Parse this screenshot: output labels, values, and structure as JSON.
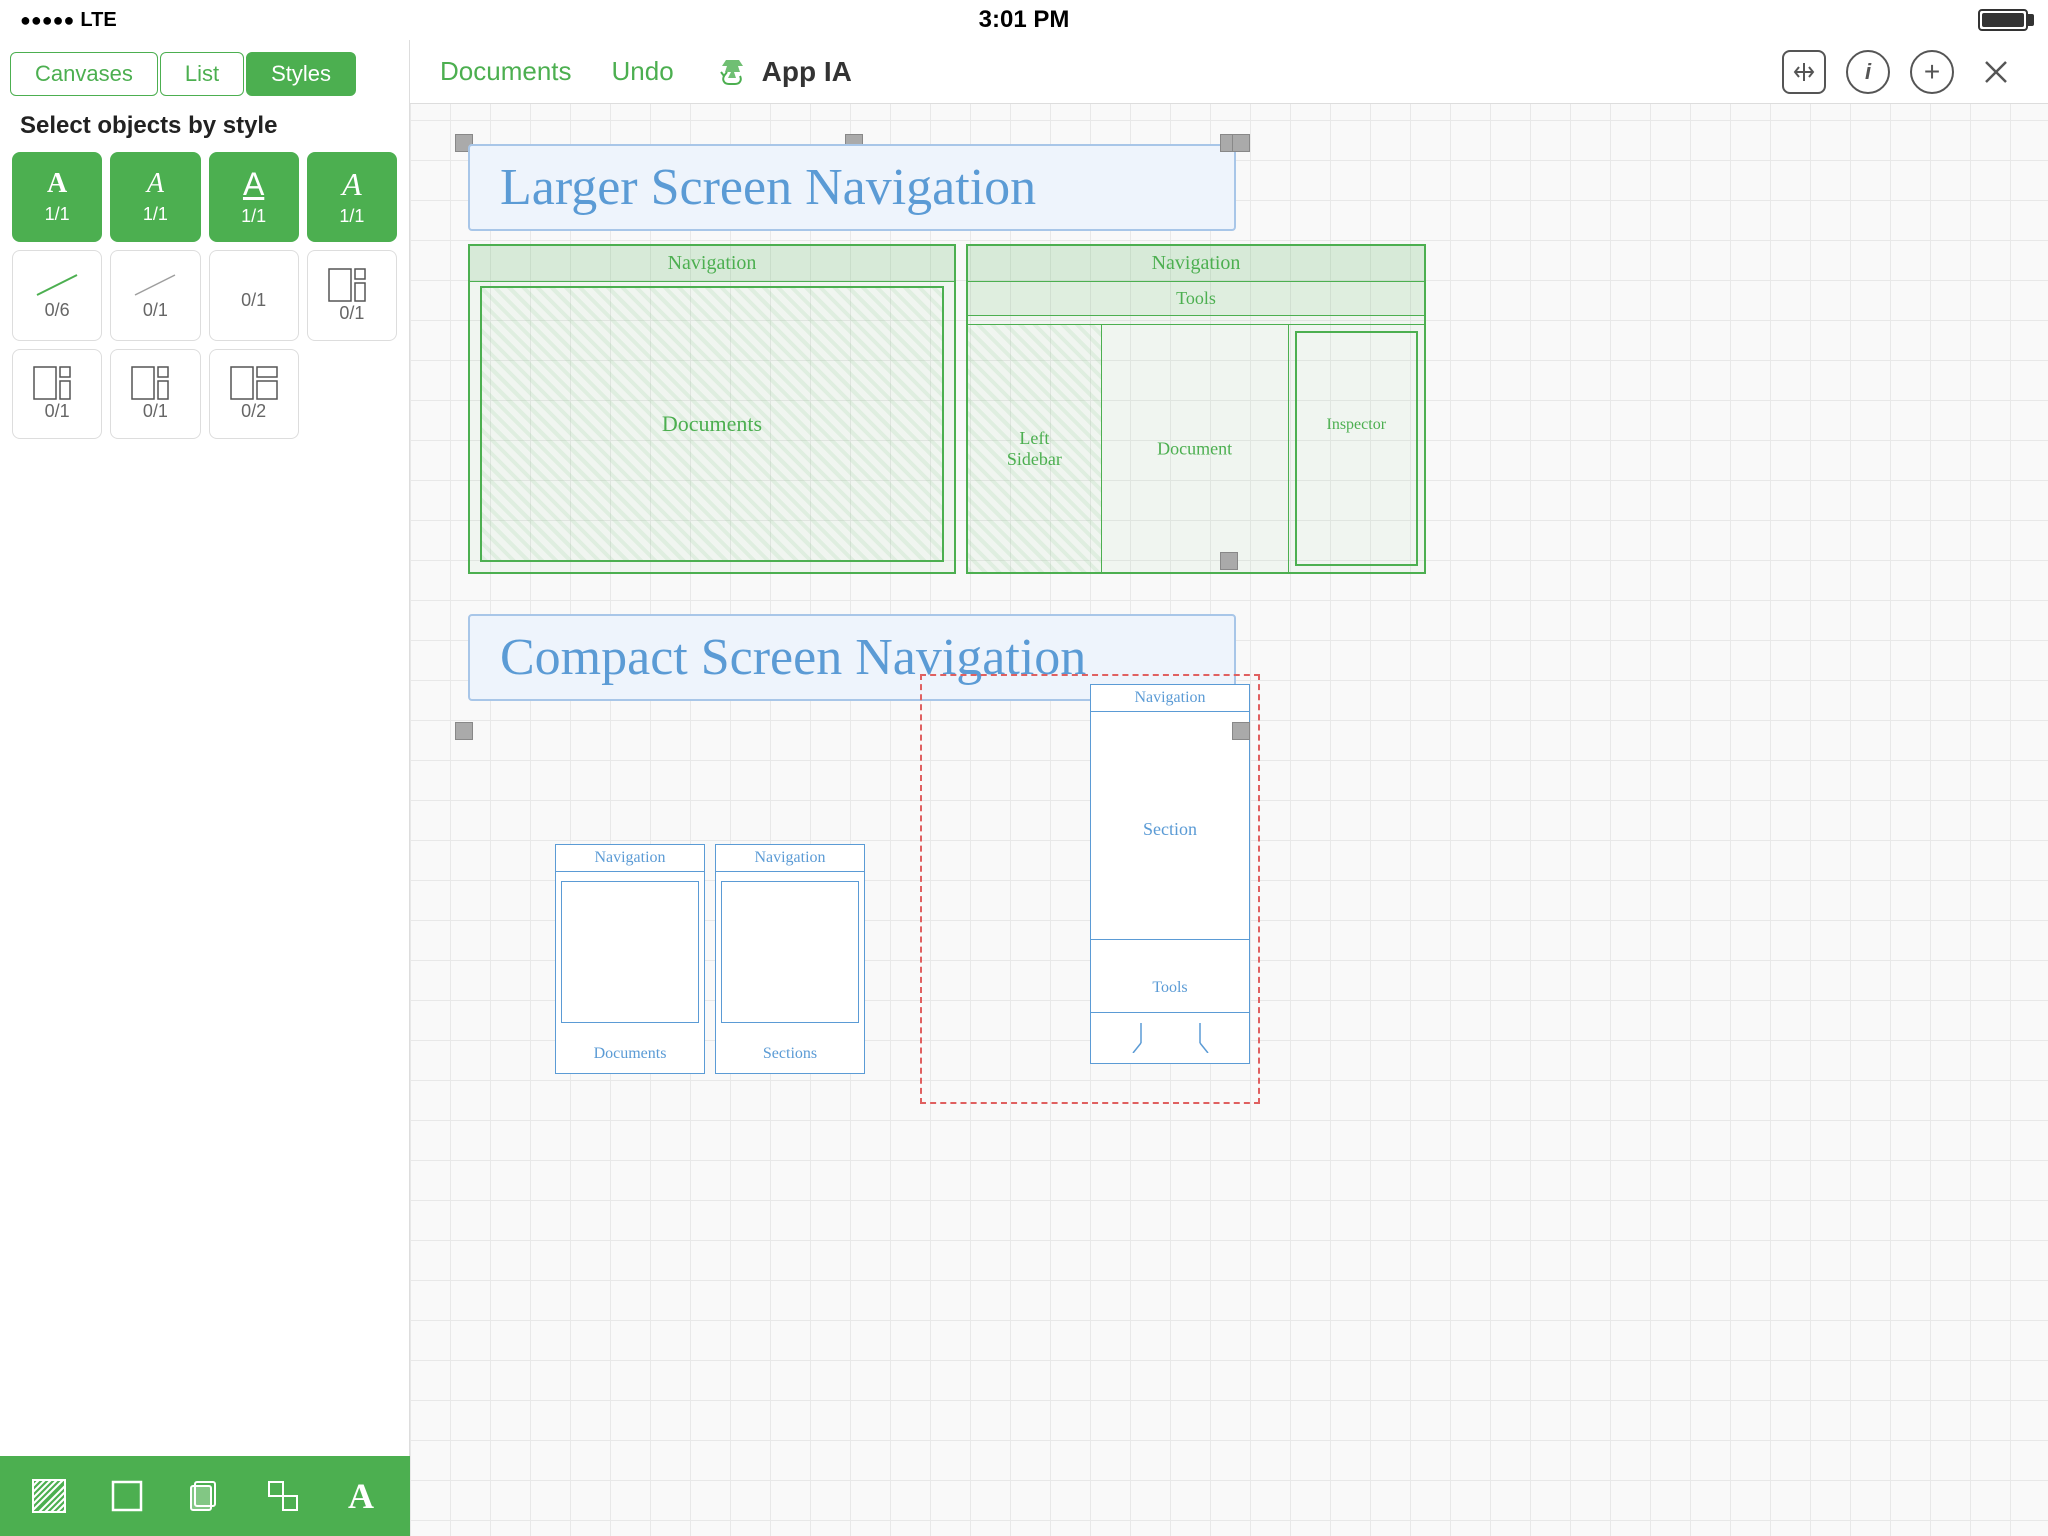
{
  "statusBar": {
    "signal": "●●●●●",
    "carrier": "LTE",
    "time": "3:01 PM"
  },
  "leftPanel": {
    "tabs": [
      {
        "label": "Canvases",
        "active": false
      },
      {
        "label": "List",
        "active": false
      },
      {
        "label": "Styles",
        "active": true
      }
    ],
    "title": "Select objects by style",
    "styles": [
      {
        "type": "text",
        "label": "1/1",
        "variant": "bold"
      },
      {
        "type": "text",
        "label": "1/1",
        "variant": "italic"
      },
      {
        "type": "text",
        "label": "1/1",
        "variant": "hand-selected"
      },
      {
        "type": "text",
        "label": "1/1",
        "variant": "plain"
      },
      {
        "type": "line",
        "label": "0/6",
        "variant": "diagonal"
      },
      {
        "type": "line",
        "label": "0/1",
        "variant": "diagonal-light"
      },
      {
        "type": "shape",
        "label": "0/1",
        "variant": "empty"
      },
      {
        "type": "shape",
        "label": "0/1",
        "variant": "complex"
      },
      {
        "type": "shape",
        "label": "0/1",
        "variant": "complex2"
      },
      {
        "type": "shape",
        "label": "0/1",
        "variant": "complex3"
      },
      {
        "type": "shape",
        "label": "0/2",
        "variant": "complex4"
      }
    ]
  },
  "mainToolbar": {
    "links": [
      "Documents",
      "Undo"
    ],
    "title": "App IA",
    "icons": [
      "move",
      "info",
      "add",
      "close"
    ]
  },
  "canvas": {
    "largerScreenTitle": "Larger Screen Navigation",
    "compactScreenTitle": "Compact Screen Navigation",
    "navigationLabel": "Navigation",
    "toolsLabel": "Tools",
    "documentsLabel": "Documents",
    "leftSidebarLabel": "Left\nSidebar",
    "documentLabel": "Document",
    "inspectorLabel": "Inspector",
    "sectionsLabel": "Sections",
    "sectionLabel": "Section"
  },
  "bottomToolbar": {
    "buttons": [
      "hatch",
      "rect",
      "copy",
      "shape",
      "text"
    ]
  }
}
